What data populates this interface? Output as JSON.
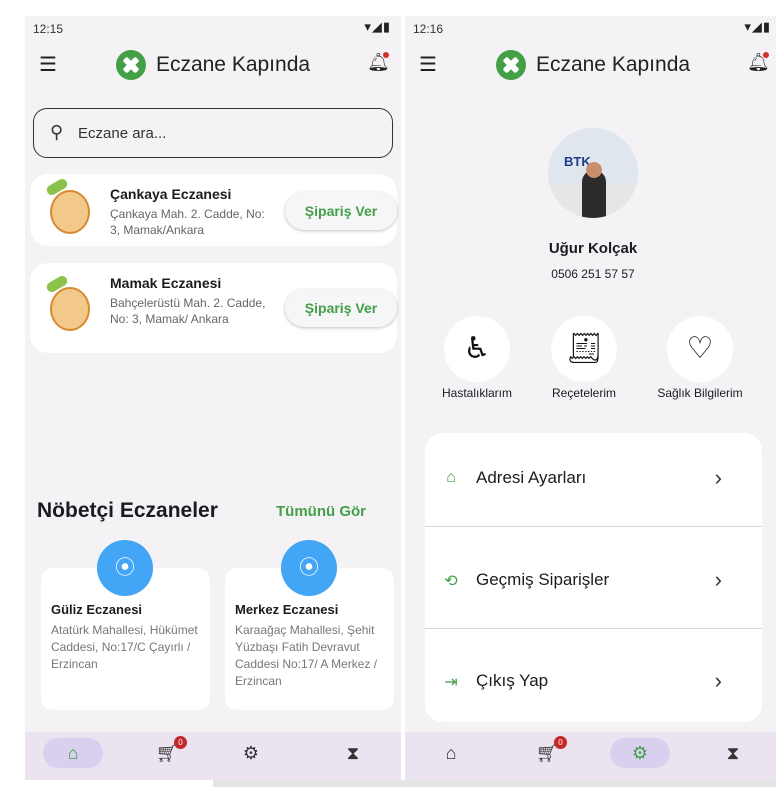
{
  "left": {
    "status": {
      "time": "12:15",
      "icons": "▾◢▮"
    },
    "app_title": "Eczane Kapında",
    "search": {
      "placeholder": "Eczane ara..."
    },
    "pharmacies": [
      {
        "name": "Çankaya Eczanesi",
        "address": "Çankaya Mah. 2. Cadde, No: 3, Mamak/Ankara",
        "button": "Şipariş Ver"
      },
      {
        "name": "Mamak Eczanesi",
        "address": "Bahçelerüstü Mah. 2. Cadde, No: 3, Mamak/ Ankara",
        "button": "Şipariş Ver"
      }
    ],
    "duty_section": {
      "title": "Nöbetçi Eczaneler",
      "see_all": "Tümünü Gör"
    },
    "duty_pharmacies": [
      {
        "name": "Güliz Eczanesi",
        "address": "Atatürk Mahallesi, Hükümet Caddesi, No:17/C Çayırlı / Erzincan"
      },
      {
        "name": "Merkez Eczanesi",
        "address": "Karaağaç Mahallesi, Şehit Yüzbaşı Fatih Devravut Caddesi No:17/ A Merkez / Erzincan"
      }
    ],
    "cart_badge": "0"
  },
  "right": {
    "status": {
      "time": "12:16",
      "icons": "▾◢▮"
    },
    "app_title": "Eczane Kapında",
    "profile": {
      "name": "Uğur Kolçak",
      "phone": "0506 251 57 57",
      "photo_text": "BTK"
    },
    "quick_actions": [
      {
        "label": "Hastalıklarım",
        "icon": "patient-icon"
      },
      {
        "label": "Reçetelerim",
        "icon": "receipt-icon"
      },
      {
        "label": "Sağlık Bilgilerim",
        "icon": "heart-icon"
      }
    ],
    "settings": [
      {
        "label": "Adresi Ayarları",
        "icon": "home-icon"
      },
      {
        "label": "Geçmiş Siparişler",
        "icon": "history-icon"
      },
      {
        "label": "Çıkış Yap",
        "icon": "logout-icon"
      }
    ],
    "cart_badge": "0"
  },
  "colors": {
    "accent_green": "#43a047",
    "pin_blue": "#42a5f5",
    "nav_bg": "#ebe3ef",
    "badge_red": "#c62828"
  }
}
